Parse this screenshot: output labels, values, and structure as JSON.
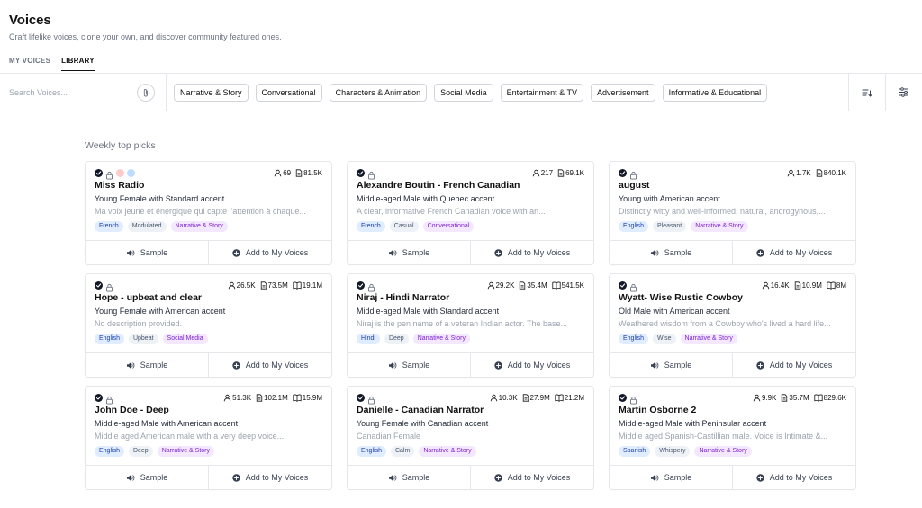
{
  "page": {
    "title": "Voices",
    "subtitle": "Craft lifelike voices, clone your own, and discover community featured ones."
  },
  "tabs": [
    {
      "label": "MY VOICES",
      "active": false
    },
    {
      "label": "LIBRARY",
      "active": true
    }
  ],
  "search": {
    "placeholder": "Search Voices...",
    "value": ""
  },
  "categories": [
    "Narrative & Story",
    "Conversational",
    "Characters & Animation",
    "Social Media",
    "Entertainment & TV",
    "Advertisement",
    "Informative & Educational"
  ],
  "section_title": "Weekly top picks",
  "actions": {
    "sample": "Sample",
    "add": "Add to My Voices"
  },
  "colors": {
    "accent": "#111827",
    "lang_tag": "#e0ecff",
    "trait_tag": "#eef2f7",
    "category_tag": "#f3e8ff"
  },
  "voices": [
    {
      "name": "Miss Radio",
      "accent": "Young Female with Standard accent",
      "description": "Ma voix jeune et énergique qui capte l'attention à chaque...",
      "stats": [
        "69",
        "81.5K"
      ],
      "tags": [
        "French",
        "Modulated",
        "Narrative & Story"
      ],
      "extra_dots": [
        "#fecaca",
        "#bfdbfe"
      ]
    },
    {
      "name": "Alexandre Boutin - French Canadian",
      "accent": "Middle-aged Male with Quebec accent",
      "description": "A clear, informative French Canadian voice with an...",
      "stats": [
        "217",
        "69.1K"
      ],
      "tags": [
        "French",
        "Casual",
        "Conversational"
      ],
      "extra_dots": []
    },
    {
      "name": "august",
      "accent": "Young with American accent",
      "description": "Distinctly witty and well-informed, natural, androgynous,...",
      "stats": [
        "1.7K",
        "840.1K"
      ],
      "tags": [
        "English",
        "Pleasant",
        "Narrative & Story"
      ],
      "extra_dots": []
    },
    {
      "name": "Hope - upbeat and clear",
      "accent": "Young Female with American accent",
      "description": "No description provided.",
      "stats": [
        "26.5K",
        "73.5M",
        "19.1M"
      ],
      "tags": [
        "English",
        "Upbeat",
        "Social Media"
      ],
      "extra_dots": []
    },
    {
      "name": "Niraj - Hindi Narrator",
      "accent": "Middle-aged Male with Standard accent",
      "description": "Niraj is the pen name of a veteran Indian actor. The base...",
      "stats": [
        "29.2K",
        "35.4M",
        "541.5K"
      ],
      "tags": [
        "Hindi",
        "Deep",
        "Narrative & Story"
      ],
      "extra_dots": []
    },
    {
      "name": "Wyatt- Wise Rustic Cowboy",
      "accent": "Old Male with American accent",
      "description": "Weathered wisdom from a Cowboy who's lived a hard life...",
      "stats": [
        "16.4K",
        "10.9M",
        "8M"
      ],
      "tags": [
        "English",
        "Wise",
        "Narrative & Story"
      ],
      "extra_dots": []
    },
    {
      "name": "John Doe - Deep",
      "accent": "Middle-aged Male with American accent",
      "description": "Middle aged American male with a very deep voice....",
      "stats": [
        "51.3K",
        "102.1M",
        "15.9M"
      ],
      "tags": [
        "English",
        "Deep",
        "Narrative & Story"
      ],
      "extra_dots": []
    },
    {
      "name": "Danielle - Canadian Narrator",
      "accent": "Young Female with Canadian accent",
      "description": "Canadian Female",
      "stats": [
        "10.3K",
        "27.9M",
        "21.2M"
      ],
      "tags": [
        "English",
        "Calm",
        "Narrative & Story"
      ],
      "extra_dots": []
    },
    {
      "name": "Martin Osborne 2",
      "accent": "Middle-aged Male with Peninsular accent",
      "description": "Middle aged Spanish-Castillian male. Voice is Intimate &...",
      "stats": [
        "9.9K",
        "35.7M",
        "829.6K"
      ],
      "tags": [
        "Spanish",
        "Whispery",
        "Narrative & Story"
      ],
      "extra_dots": []
    }
  ]
}
